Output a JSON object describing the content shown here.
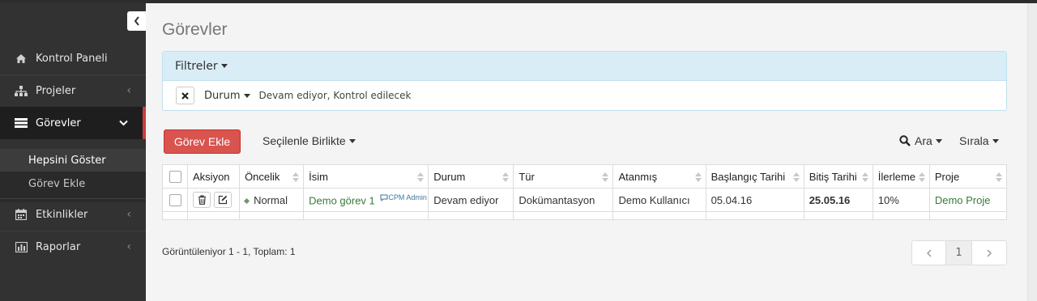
{
  "sidebar": {
    "items": [
      {
        "label": "Kontrol Paneli",
        "icon": "home-icon"
      },
      {
        "label": "Projeler",
        "icon": "sitemap-icon"
      },
      {
        "label": "Görevler",
        "icon": "tasks-icon"
      },
      {
        "label": "Etkinlikler",
        "icon": "calendar-icon"
      },
      {
        "label": "Raporlar",
        "icon": "bar-chart-icon"
      }
    ],
    "submenu": [
      {
        "label": "Hepsini Göster"
      },
      {
        "label": "Görev Ekle"
      }
    ],
    "accent": "#cf3a37"
  },
  "page": {
    "title": "Görevler"
  },
  "filters": {
    "header": "Filtreler",
    "field": "Durum",
    "value": "Devam ediyor, Kontrol edilecek"
  },
  "toolbar": {
    "add_label": "Görev Ekle",
    "bulk_label": "Seçilenle Birlikte",
    "search_label": "Ara",
    "sort_label": "Sırala"
  },
  "table": {
    "columns": [
      "Aksiyon",
      "Öncelik",
      "İsim",
      "Durum",
      "Tür",
      "Atanmış",
      "Başlangıç Tarihi",
      "Bitiş Tarihi",
      "İlerleme",
      "Proje"
    ],
    "rows": [
      {
        "priority": "Normal",
        "name": "Demo görev 1",
        "comment": "CPM Admin",
        "status": "Devam ediyor",
        "type": "Dokümantasyon",
        "assignee": "Demo Kullanıcı",
        "start": "05.04.16",
        "end": "25.05.16",
        "progress": "10%",
        "project": "Demo Proje"
      }
    ]
  },
  "footer": {
    "summary": "Görüntüleniyor 1 - 1, Toplam: 1",
    "current_page": "1"
  }
}
